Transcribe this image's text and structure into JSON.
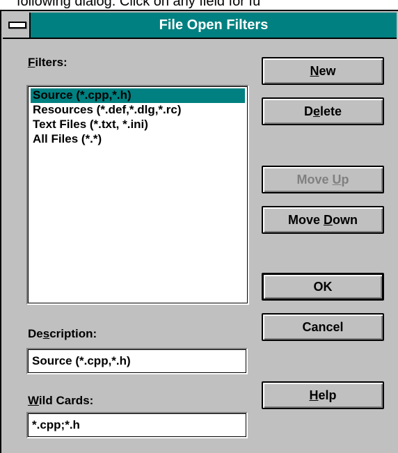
{
  "background_caption": "following dialog. Click on any field for fu",
  "dialog": {
    "title": "File Open Filters",
    "filters_label": {
      "pre": "",
      "key": "F",
      "post": "ilters:"
    },
    "filters": [
      {
        "label": "Source (*.cpp,*.h)",
        "selected": true
      },
      {
        "label": "Resources (*.def,*.dlg,*.rc)",
        "selected": false
      },
      {
        "label": "Text Files (*.txt, *.ini)",
        "selected": false
      },
      {
        "label": "All Files (*.*)",
        "selected": false
      }
    ],
    "description_label": {
      "pre": "De",
      "key": "s",
      "post": "cription:"
    },
    "description_value": "Source (*.cpp,*.h)",
    "wildcards_label": {
      "pre": "",
      "key": "W",
      "post": "ild Cards:"
    },
    "wildcards_value": "*.cpp;*.h",
    "buttons": {
      "new": {
        "pre": "",
        "key": "N",
        "post": "ew"
      },
      "delete": {
        "pre": "D",
        "key": "e",
        "post": "lete"
      },
      "move_up": {
        "pre": "Move ",
        "key": "U",
        "post": "p"
      },
      "move_down": {
        "pre": "Move ",
        "key": "D",
        "post": "own"
      },
      "ok": {
        "pre": "OK",
        "key": "",
        "post": ""
      },
      "cancel": {
        "pre": "Cancel",
        "key": "",
        "post": ""
      },
      "help": {
        "pre": "",
        "key": "H",
        "post": "elp"
      }
    }
  },
  "colors": {
    "title_bar": "#008080",
    "selection": "#008080",
    "face": "#c0c0c0",
    "disabled_text": "#808080"
  },
  "icons": {
    "system_menu": "system-menu-icon"
  }
}
